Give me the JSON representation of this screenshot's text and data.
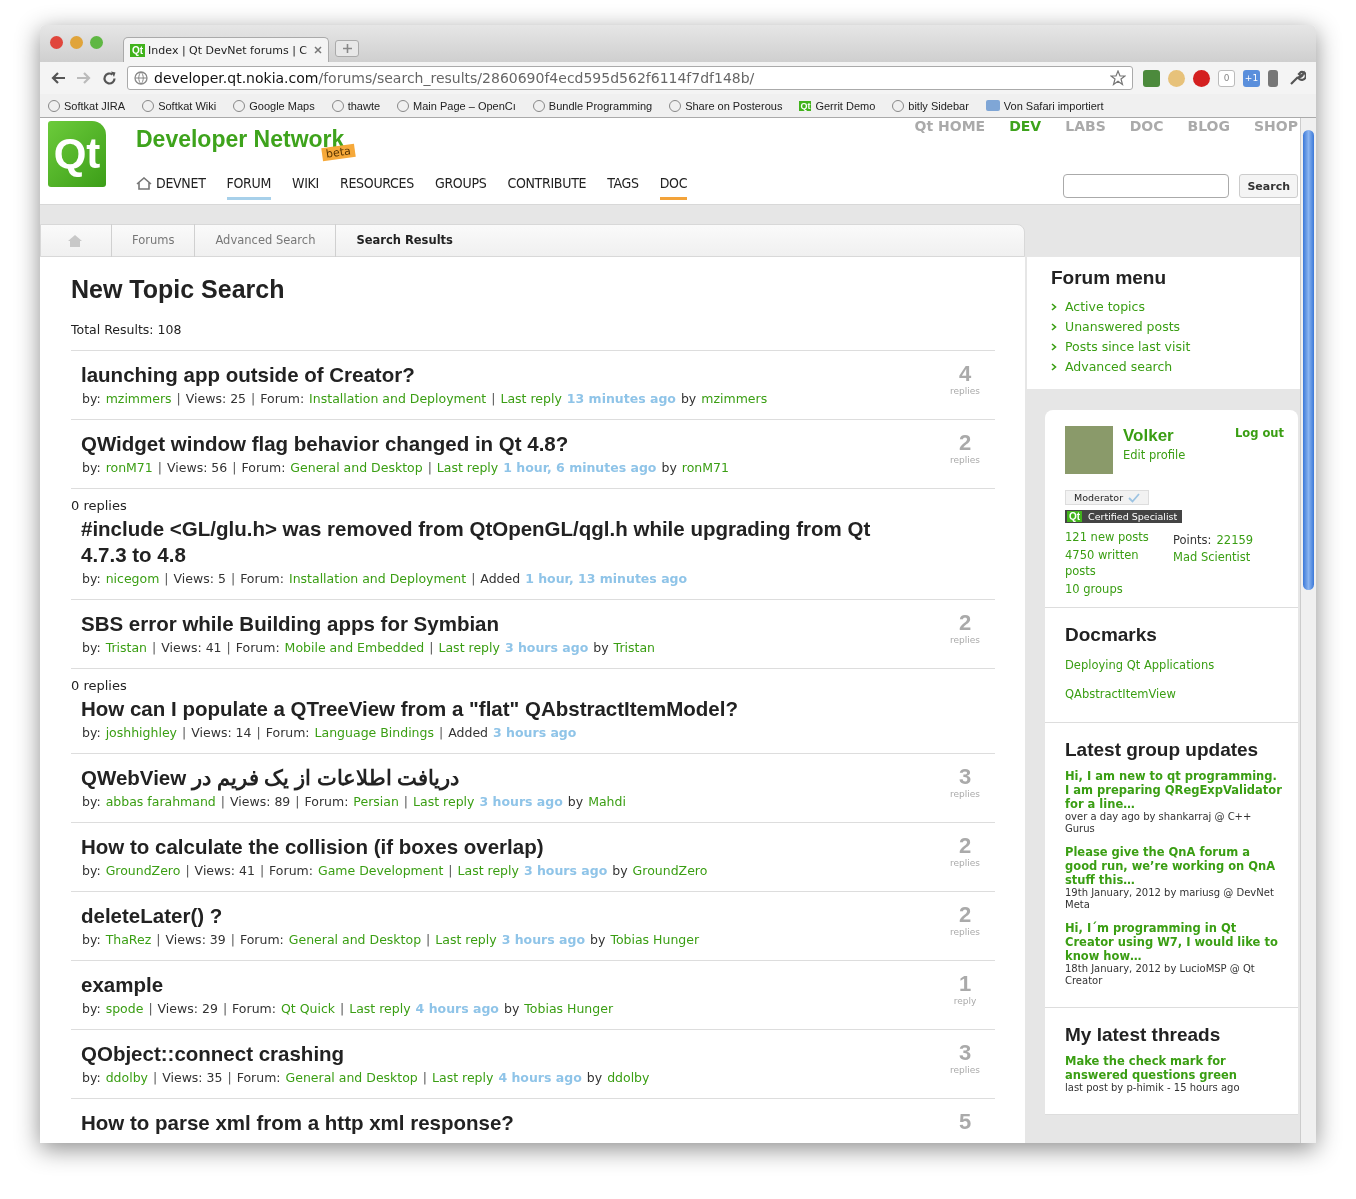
{
  "browser": {
    "tab": {
      "icon_text": "Qt",
      "title": "Index | Qt DevNet forums | C"
    },
    "url": {
      "host": "developer.qt.nokia.com",
      "path": "/forums/search_results/2860690f4ecd595d562f6114f7df148b/"
    },
    "extensions": [
      {
        "kind": "note"
      },
      {
        "kind": "face"
      },
      {
        "kind": "stop"
      },
      {
        "kind": "counter",
        "label": "0"
      },
      {
        "kind": "calendar",
        "label": "+1"
      },
      {
        "kind": "tool"
      }
    ],
    "bookmarks": [
      {
        "kind": "link",
        "label": "Softkat JIRA"
      },
      {
        "kind": "link",
        "label": "Softkat Wiki"
      },
      {
        "kind": "link",
        "label": "Google Maps"
      },
      {
        "kind": "link",
        "label": "thawte"
      },
      {
        "kind": "link",
        "label": "Main Page – OpenCı"
      },
      {
        "kind": "link",
        "label": "Bundle Programming"
      },
      {
        "kind": "link",
        "label": "Share on Posterous"
      },
      {
        "kind": "link",
        "label": "Gerrit Demo",
        "icon_text": "Qt"
      },
      {
        "kind": "link",
        "label": "bitly Sidebar"
      },
      {
        "kind": "folder",
        "label": "Von Safari importiert"
      }
    ]
  },
  "header": {
    "logo_text": "Qt",
    "site_title": "Developer Network",
    "beta_badge": "beta",
    "top_links": [
      {
        "label": "Qt HOME",
        "selected": false
      },
      {
        "label": "DEV",
        "selected": true
      },
      {
        "label": "LABS",
        "selected": false
      },
      {
        "label": "DOC",
        "selected": false
      },
      {
        "label": "BLOG",
        "selected": false
      },
      {
        "label": "SHOP",
        "selected": false
      }
    ],
    "nav": [
      {
        "label": "DEVNET",
        "home": true,
        "selected": false,
        "highlighted": false
      },
      {
        "label": "FORUM",
        "home": false,
        "selected": true,
        "highlighted": false
      },
      {
        "label": "WIKI",
        "home": false,
        "selected": false,
        "highlighted": false
      },
      {
        "label": "RESOURCES",
        "home": false,
        "selected": false,
        "highlighted": false
      },
      {
        "label": "GROUPS",
        "home": false,
        "selected": false,
        "highlighted": false
      },
      {
        "label": "CONTRIBUTE",
        "home": false,
        "selected": false,
        "highlighted": false
      },
      {
        "label": "TAGS",
        "home": false,
        "selected": false,
        "highlighted": false
      },
      {
        "label": "DOC",
        "home": false,
        "selected": false,
        "highlighted": true
      }
    ],
    "search_button": "Search"
  },
  "breadcrumbs": [
    {
      "label": "Forums",
      "current": false
    },
    {
      "label": "Advanced Search",
      "current": false
    },
    {
      "label": "Search Results",
      "current": true
    }
  ],
  "main": {
    "title": "New Topic Search",
    "total": "Total Results: 108",
    "topics": [
      {
        "kind": "count",
        "title": "launching app outside of Creator?",
        "count": "4",
        "count_label": "replies",
        "meta": [
          {
            "kind": "label",
            "text": "by:"
          },
          {
            "kind": "link",
            "text": "mzimmers"
          },
          {
            "kind": "sep",
            "text": "|"
          },
          {
            "kind": "label",
            "text": "Views: 25"
          },
          {
            "kind": "sep",
            "text": "|"
          },
          {
            "kind": "label",
            "text": "Forum:"
          },
          {
            "kind": "link",
            "text": "Installation and Deployment"
          },
          {
            "kind": "sep",
            "text": "|"
          },
          {
            "kind": "link",
            "text": "Last reply"
          },
          {
            "kind": "time",
            "text": "13 minutes ago"
          },
          {
            "kind": "label",
            "text": "by"
          },
          {
            "kind": "link",
            "text": "mzimmers"
          }
        ]
      },
      {
        "kind": "count",
        "title": "QWidget window flag behavior changed in Qt 4.8?",
        "count": "2",
        "count_label": "replies",
        "meta": [
          {
            "kind": "label",
            "text": "by:"
          },
          {
            "kind": "link",
            "text": "ronM71"
          },
          {
            "kind": "sep",
            "text": "|"
          },
          {
            "kind": "label",
            "text": "Views: 56"
          },
          {
            "kind": "sep",
            "text": "|"
          },
          {
            "kind": "label",
            "text": "Forum:"
          },
          {
            "kind": "link",
            "text": "General and Desktop"
          },
          {
            "kind": "sep",
            "text": "|"
          },
          {
            "kind": "link",
            "text": "Last reply"
          },
          {
            "kind": "time",
            "text": "1 hour, 6 minutes ago"
          },
          {
            "kind": "label",
            "text": "by"
          },
          {
            "kind": "link",
            "text": "ronM71"
          }
        ]
      },
      {
        "kind": "note",
        "note": "0 replies",
        "title": "#include <GL/glu.h> was removed from QtOpenGL/qgl.h while upgrading from Qt 4.7.3 to 4.8",
        "meta": [
          {
            "kind": "label",
            "text": "by:"
          },
          {
            "kind": "link",
            "text": "nicegom"
          },
          {
            "kind": "sep",
            "text": "|"
          },
          {
            "kind": "label",
            "text": "Views: 5"
          },
          {
            "kind": "sep",
            "text": "|"
          },
          {
            "kind": "label",
            "text": "Forum:"
          },
          {
            "kind": "link",
            "text": "Installation and Deployment"
          },
          {
            "kind": "sep",
            "text": "|"
          },
          {
            "kind": "label",
            "text": "Added"
          },
          {
            "kind": "time",
            "text": "1 hour, 13 minutes ago"
          }
        ]
      },
      {
        "kind": "count",
        "title": "SBS error while Building apps for Symbian",
        "count": "2",
        "count_label": "replies",
        "meta": [
          {
            "kind": "label",
            "text": "by:"
          },
          {
            "kind": "link",
            "text": "Tristan"
          },
          {
            "kind": "sep",
            "text": "|"
          },
          {
            "kind": "label",
            "text": "Views: 41"
          },
          {
            "kind": "sep",
            "text": "|"
          },
          {
            "kind": "label",
            "text": "Forum:"
          },
          {
            "kind": "link",
            "text": "Mobile and Embedded"
          },
          {
            "kind": "sep",
            "text": "|"
          },
          {
            "kind": "link",
            "text": "Last reply"
          },
          {
            "kind": "time",
            "text": "3 hours ago"
          },
          {
            "kind": "label",
            "text": "by"
          },
          {
            "kind": "link",
            "text": "Tristan"
          }
        ]
      },
      {
        "kind": "note",
        "note": "0 replies",
        "title": "How can I populate a QTreeView from a \"flat\" QAbstractItemModel?",
        "meta": [
          {
            "kind": "label",
            "text": "by:"
          },
          {
            "kind": "link",
            "text": "joshhighley"
          },
          {
            "kind": "sep",
            "text": "|"
          },
          {
            "kind": "label",
            "text": "Views: 14"
          },
          {
            "kind": "sep",
            "text": "|"
          },
          {
            "kind": "label",
            "text": "Forum:"
          },
          {
            "kind": "link",
            "text": "Language Bindings"
          },
          {
            "kind": "sep",
            "text": "|"
          },
          {
            "kind": "label",
            "text": "Added"
          },
          {
            "kind": "time",
            "text": "3 hours ago"
          }
        ]
      },
      {
        "kind": "count",
        "title": "QWebView دریافت اطلاعات از یک فریم در",
        "count": "3",
        "count_label": "replies",
        "meta": [
          {
            "kind": "label",
            "text": "by:"
          },
          {
            "kind": "link",
            "text": "abbas farahmand"
          },
          {
            "kind": "sep",
            "text": "|"
          },
          {
            "kind": "label",
            "text": "Views: 89"
          },
          {
            "kind": "sep",
            "text": "|"
          },
          {
            "kind": "label",
            "text": "Forum:"
          },
          {
            "kind": "link",
            "text": "Persian"
          },
          {
            "kind": "sep",
            "text": "|"
          },
          {
            "kind": "link",
            "text": "Last reply"
          },
          {
            "kind": "time",
            "text": "3 hours ago"
          },
          {
            "kind": "label",
            "text": "by"
          },
          {
            "kind": "link",
            "text": "Mahdi"
          }
        ]
      },
      {
        "kind": "count",
        "title": "How to calculate the collision (if boxes overlap)",
        "count": "2",
        "count_label": "replies",
        "meta": [
          {
            "kind": "label",
            "text": "by:"
          },
          {
            "kind": "link",
            "text": "GroundZero"
          },
          {
            "kind": "sep",
            "text": "|"
          },
          {
            "kind": "label",
            "text": "Views: 41"
          },
          {
            "kind": "sep",
            "text": "|"
          },
          {
            "kind": "label",
            "text": "Forum:"
          },
          {
            "kind": "link",
            "text": "Game Development"
          },
          {
            "kind": "sep",
            "text": "|"
          },
          {
            "kind": "link",
            "text": "Last reply"
          },
          {
            "kind": "time",
            "text": "3 hours ago"
          },
          {
            "kind": "label",
            "text": "by"
          },
          {
            "kind": "link",
            "text": "GroundZero"
          }
        ]
      },
      {
        "kind": "count",
        "title": "deleteLater() ?",
        "count": "2",
        "count_label": "replies",
        "meta": [
          {
            "kind": "label",
            "text": "by:"
          },
          {
            "kind": "link",
            "text": "ThaRez"
          },
          {
            "kind": "sep",
            "text": "|"
          },
          {
            "kind": "label",
            "text": "Views: 39"
          },
          {
            "kind": "sep",
            "text": "|"
          },
          {
            "kind": "label",
            "text": "Forum:"
          },
          {
            "kind": "link",
            "text": "General and Desktop"
          },
          {
            "kind": "sep",
            "text": "|"
          },
          {
            "kind": "link",
            "text": "Last reply"
          },
          {
            "kind": "time",
            "text": "3 hours ago"
          },
          {
            "kind": "label",
            "text": "by"
          },
          {
            "kind": "link",
            "text": "Tobias Hunger"
          }
        ]
      },
      {
        "kind": "count",
        "title": "example",
        "count": "1",
        "count_label": "reply",
        "meta": [
          {
            "kind": "label",
            "text": "by:"
          },
          {
            "kind": "link",
            "text": "spode"
          },
          {
            "kind": "sep",
            "text": "|"
          },
          {
            "kind": "label",
            "text": "Views: 29"
          },
          {
            "kind": "sep",
            "text": "|"
          },
          {
            "kind": "label",
            "text": "Forum:"
          },
          {
            "kind": "link",
            "text": "Qt Quick"
          },
          {
            "kind": "sep",
            "text": "|"
          },
          {
            "kind": "link",
            "text": "Last reply"
          },
          {
            "kind": "time",
            "text": "4 hours ago"
          },
          {
            "kind": "label",
            "text": "by"
          },
          {
            "kind": "link",
            "text": "Tobias Hunger"
          }
        ]
      },
      {
        "kind": "count",
        "title": "QObject::connect crashing",
        "count": "3",
        "count_label": "replies",
        "meta": [
          {
            "kind": "label",
            "text": "by:"
          },
          {
            "kind": "link",
            "text": "ddolby"
          },
          {
            "kind": "sep",
            "text": "|"
          },
          {
            "kind": "label",
            "text": "Views: 35"
          },
          {
            "kind": "sep",
            "text": "|"
          },
          {
            "kind": "label",
            "text": "Forum:"
          },
          {
            "kind": "link",
            "text": "General and Desktop"
          },
          {
            "kind": "sep",
            "text": "|"
          },
          {
            "kind": "link",
            "text": "Last reply"
          },
          {
            "kind": "time",
            "text": "4 hours ago"
          },
          {
            "kind": "label",
            "text": "by"
          },
          {
            "kind": "link",
            "text": "ddolby"
          }
        ]
      },
      {
        "kind": "count",
        "title": "How to parse xml from a http xml response?",
        "count": "5"
      }
    ]
  },
  "sidebar": {
    "forum_menu": {
      "title": "Forum menu",
      "items": [
        "Active topics",
        "Unanswered posts",
        "Posts since last visit",
        "Advanced search"
      ]
    },
    "profile": {
      "name": "Volker",
      "edit": "Edit profile",
      "logout": "Log out",
      "role": "Moderator",
      "cert_logo": "Qt",
      "cert": "Certified Specialist",
      "stats": [
        "121 new posts",
        "4750 written posts",
        "10 groups"
      ],
      "points_label": "Points:",
      "points": "22159",
      "rank": "Mad Scientist"
    },
    "docmarks": {
      "title": "Docmarks",
      "items": [
        "Deploying Qt Applications",
        "QAbstractItemView"
      ]
    },
    "group_updates": {
      "title": "Latest group updates",
      "items": [
        {
          "title": "Hi, I am new to qt programming. I am preparing QRegExpValidator for a line…",
          "info": "over a day ago by shankarraj @ C++ Gurus"
        },
        {
          "title": "Please give the QnA forum a good run, we’re working on QnA stuff this…",
          "info": "19th January, 2012 by mariusg @ DevNet Meta"
        },
        {
          "title": "Hi, I´m programming in Qt Creator using W7, I would like to know how…",
          "info": "18th January, 2012 by LucioMSP @ Qt Creator"
        }
      ]
    },
    "latest_threads": {
      "title": "My latest threads",
      "items": [
        {
          "title": "Make the check mark for answered questions green",
          "info": "last post by p-himik - 15 hours ago"
        }
      ]
    }
  }
}
